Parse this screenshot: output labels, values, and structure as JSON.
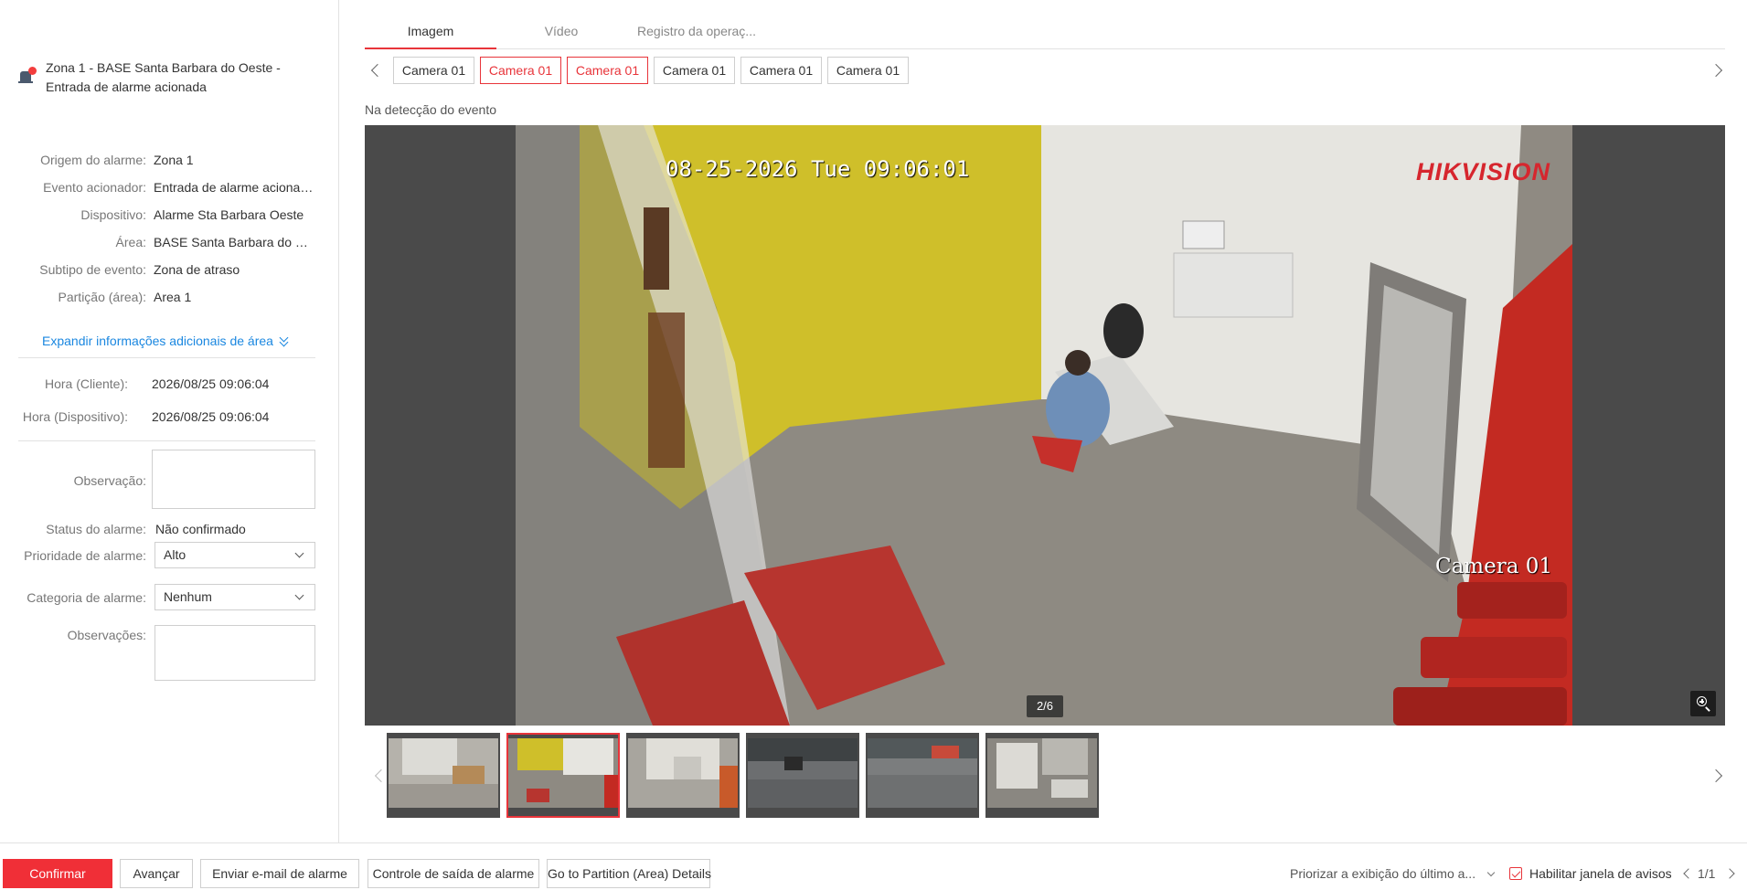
{
  "alarm": {
    "title": "Zona 1 - BASE Santa Barbara do Oeste - Entrada de alarme acionada",
    "icon": "alarm-siren-icon"
  },
  "details": [
    {
      "label": "Origem do alarme:",
      "value": "Zona 1"
    },
    {
      "label": "Evento acionador:",
      "value": "Entrada de alarme acionada"
    },
    {
      "label": "Dispositivo:",
      "value": "Alarme Sta Barbara Oeste"
    },
    {
      "label": "Área:",
      "value": "BASE Santa Barbara do Oe..."
    },
    {
      "label": "Subtipo de evento:",
      "value": "Zona de atraso"
    },
    {
      "label": "Partição (área):",
      "value": "Area 1"
    }
  ],
  "expand_label": "Expandir informações adicionais de área",
  "times": [
    {
      "label": "Hora (Cliente):",
      "value": "2026/08/25 09:06:04"
    },
    {
      "label": "Hora (Dispositivo):",
      "value": "2026/08/25 09:06:04"
    }
  ],
  "form": {
    "observacao_label": "Observação:",
    "observacao_value": "",
    "status_label": "Status do alarme:",
    "status_value": "Não confirmado",
    "priority_label": "Prioridade de alarme:",
    "priority_value": "Alto",
    "category_label": "Categoria de alarme:",
    "category_value": "Nenhum",
    "remarks_label": "Observações:",
    "remarks_value": ""
  },
  "tabs": [
    {
      "label": "Imagem",
      "active": true
    },
    {
      "label": "Vídeo",
      "active": false
    },
    {
      "label": "Registro da operaç...",
      "active": false
    }
  ],
  "cameras": [
    {
      "label": "Camera 01",
      "selected": false
    },
    {
      "label": "Camera 01",
      "selected": true
    },
    {
      "label": "Camera 01",
      "selected": true
    },
    {
      "label": "Camera 01",
      "selected": false
    },
    {
      "label": "Camera 01",
      "selected": false
    },
    {
      "label": "Camera 01",
      "selected": false
    }
  ],
  "caption": "Na detecção do evento",
  "image": {
    "osd_time": "08-25-2026 Tue 09:06:01",
    "osd_camera": "Camera 01",
    "brand": "HIKVISION",
    "pager": "2/6"
  },
  "thumbnails_selected_index": 1,
  "bottom": {
    "confirm": "Confirmar",
    "next": "Avançar",
    "email": "Enviar e-mail de alarme",
    "exit_control": "Controle de saída de alarme",
    "partition_details": "Go to Partition (Area) Details",
    "priority_display": "Priorizar a exibição do último a...",
    "enable_popup": "Habilitar janela de avisos",
    "enable_popup_checked": true,
    "page": "1/1"
  },
  "colors": {
    "accent": "#f02f37",
    "link": "#1a87e0",
    "viewer_bg": "#4a4a4a"
  }
}
